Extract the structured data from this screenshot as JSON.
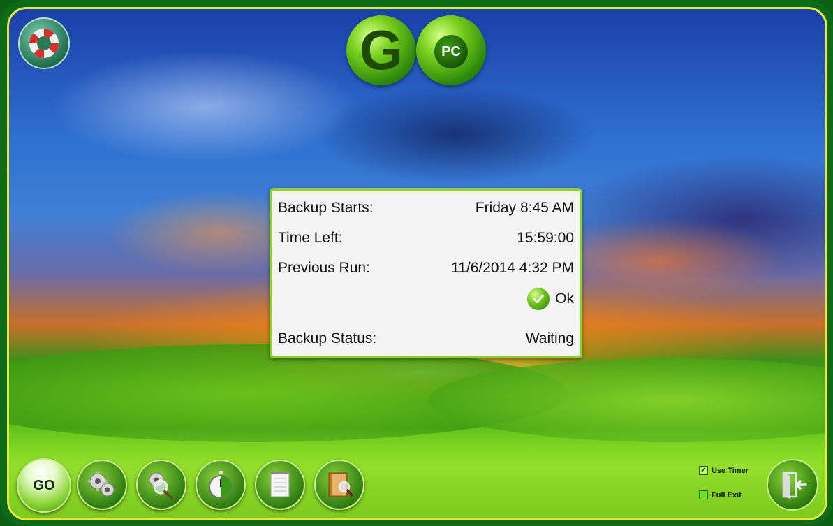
{
  "logo": {
    "letter": "G",
    "badge": "PC"
  },
  "status_panel": {
    "backup_starts_label": "Backup Starts:",
    "backup_starts_value": "Friday 8:45 AM",
    "time_left_label": "Time Left:",
    "time_left_value": "15:59:00",
    "previous_run_label": "Previous Run:",
    "previous_run_value": "11/6/2014 4:32 PM",
    "result_text": "Ok",
    "backup_status_label": "Backup Status:",
    "backup_status_value": "Waiting"
  },
  "toolbar": {
    "go_label": "GO",
    "buttons": [
      "settings-gears-icon",
      "search-settings-icon",
      "stopwatch-icon",
      "notepad-icon",
      "log-search-icon"
    ]
  },
  "options": {
    "use_timer_label": "Use Timer",
    "use_timer_checked": true,
    "full_exit_label": "Full Exit",
    "full_exit_checked": false
  },
  "icons": {
    "help": "lifebuoy-icon",
    "exit": "exit-door-icon",
    "status": "check-circle-icon"
  },
  "colors": {
    "frame": "#0d6a16",
    "border": "#e7e83a",
    "panel_border": "#8ccf3a",
    "panel_bg": "#f4f4f4"
  }
}
